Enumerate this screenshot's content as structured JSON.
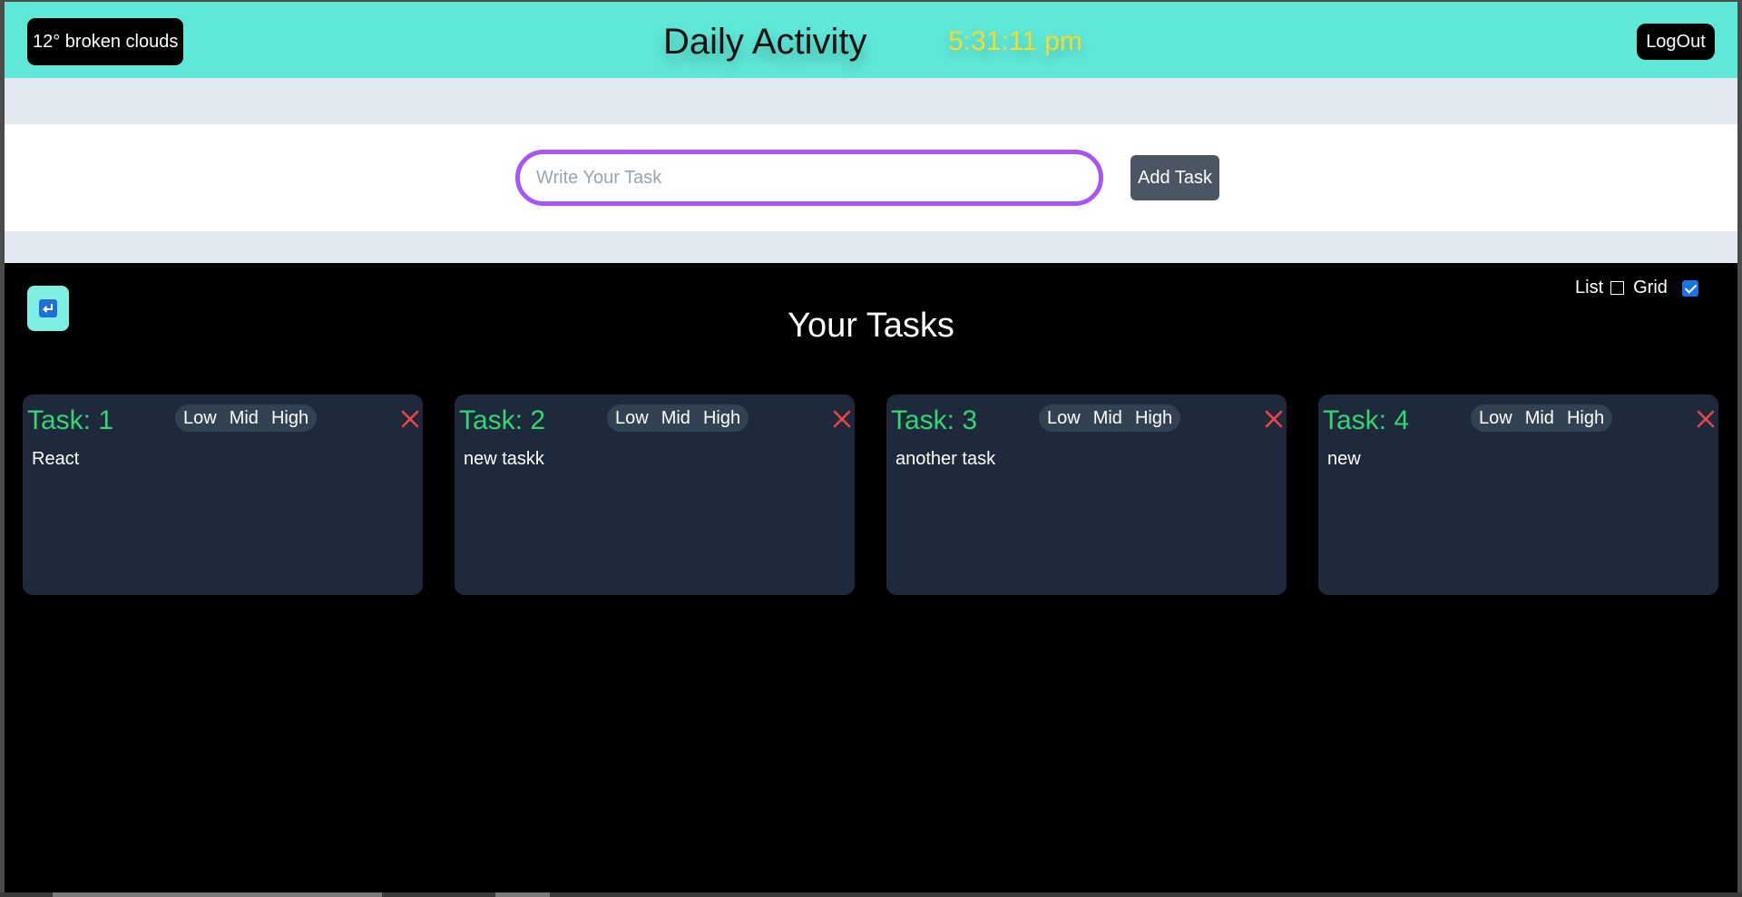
{
  "header": {
    "weather": "12° broken clouds",
    "title": "Daily Activity",
    "clock": "5:31:11 pm",
    "logout_label": "LogOut"
  },
  "task_form": {
    "placeholder": "Write Your Task",
    "value": "",
    "add_label": "Add Task"
  },
  "tasks_section": {
    "back_icon": "return-icon",
    "title": "Your Tasks",
    "view": {
      "list_label": "List",
      "list_checked": false,
      "grid_label": "Grid",
      "grid_checked": true
    }
  },
  "priorities": [
    "Low",
    "Mid",
    "High"
  ],
  "tasks": [
    {
      "title": "Task: 1",
      "text": "React"
    },
    {
      "title": "Task: 2",
      "text": "new taskk"
    },
    {
      "title": "Task: 3",
      "text": "another task"
    },
    {
      "title": "Task: 4",
      "text": "new"
    }
  ],
  "colors": {
    "header_bg": "#5fe8d8",
    "accent_purple": "#a855f7",
    "task_title_green": "#34d673",
    "clock_yellow": "#f4dc2a",
    "delete_red": "#ef4444",
    "card_bg": "#1e293b"
  }
}
